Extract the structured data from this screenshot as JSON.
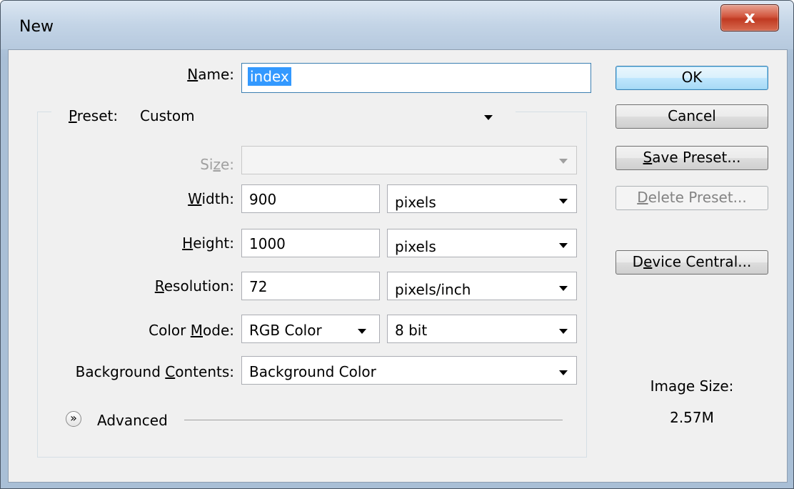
{
  "window": {
    "title": "New",
    "close_glyph": "x"
  },
  "form": {
    "name": {
      "label_u": "N",
      "label_rest": "ame:",
      "value": "index"
    },
    "preset": {
      "label_u": "P",
      "label_rest": "reset:",
      "value": "Custom"
    },
    "size": {
      "label_pre": "Si",
      "label_u": "z",
      "label_rest": "e:",
      "value": ""
    },
    "width": {
      "label_u": "W",
      "label_rest": "idth:",
      "value": "900",
      "unit": "pixels"
    },
    "height": {
      "label_u": "H",
      "label_rest": "eight:",
      "value": "1000",
      "unit": "pixels"
    },
    "resolution": {
      "label_u": "R",
      "label_rest": "esolution:",
      "value": "72",
      "unit": "pixels/inch"
    },
    "color_mode": {
      "label_pre": "Color ",
      "label_u": "M",
      "label_rest": "ode:",
      "value": "RGB Color",
      "depth": "8 bit"
    },
    "background": {
      "label_pre": "Background ",
      "label_u": "C",
      "label_rest": "ontents:",
      "value": "Background Color"
    },
    "advanced": {
      "label": "Advanced",
      "icon": "expand-chevron-icon"
    }
  },
  "buttons": {
    "ok": "OK",
    "cancel": "Cancel",
    "save_preset": {
      "u": "S",
      "rest": "ave Preset..."
    },
    "delete_preset": {
      "u": "D",
      "rest": "elete Preset..."
    },
    "device_central": {
      "pre": "D",
      "u": "e",
      "rest": "vice Central..."
    }
  },
  "image_size": {
    "label": "Image Size:",
    "value": "2.57M"
  },
  "colors": {
    "accent": "#3399ff",
    "default_button_border": "#3c7fb1",
    "disabled_text": "#a0a0a0"
  }
}
